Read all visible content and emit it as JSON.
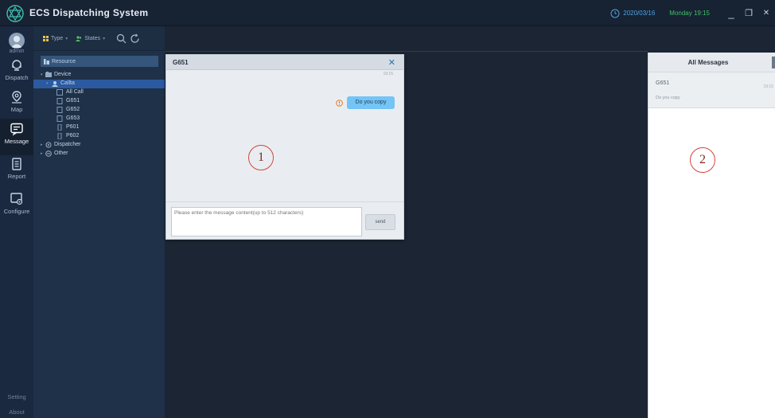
{
  "titlebar": {
    "app_title": "ECS Dispatching System",
    "date": "2020/03/16",
    "day_time": "Monday 19:15",
    "minimize": "_",
    "maximize": "❐",
    "close": "✕"
  },
  "user": {
    "name": "admin"
  },
  "nav": {
    "items": [
      {
        "label": "Dispatch",
        "icon": "dispatch-headset-icon"
      },
      {
        "label": "Map",
        "icon": "map-pin-icon"
      },
      {
        "label": "Message",
        "icon": "message-icon",
        "active": true
      },
      {
        "label": "Report",
        "icon": "report-document-icon"
      },
      {
        "label": "Configure",
        "icon": "configure-gear-icon"
      }
    ],
    "setting": "Setting",
    "about": "About"
  },
  "resource": {
    "type_label": "Type",
    "states_label": "States",
    "header": "Resource",
    "tree": [
      {
        "label": "Device",
        "level": 0
      },
      {
        "label": "Callta",
        "level": 1,
        "selected": true
      },
      {
        "label": "All Call",
        "level": 2
      },
      {
        "label": "G651",
        "level": 2
      },
      {
        "label": "G652",
        "level": 2
      },
      {
        "label": "G653",
        "level": 2
      },
      {
        "label": "P601",
        "level": 2
      },
      {
        "label": "P602",
        "level": 2
      },
      {
        "label": "Dispatcher",
        "level": 0
      },
      {
        "label": "Other",
        "level": 0
      }
    ]
  },
  "dialog": {
    "title": "G651",
    "close": "✕",
    "message_time": "19:15",
    "message_text": "Do you copy",
    "input_placeholder": "Please enter the message content(up to 512 characters)",
    "send_label": "send",
    "annotation": "1"
  },
  "messages_panel": {
    "title": "All Messages",
    "conversation": {
      "name": "G651",
      "time": "19:15",
      "preview": "Do you copy"
    },
    "annotation": "2"
  },
  "colors": {
    "titlebar_bg": "#172232",
    "nav_bg": "#1a2840",
    "panel_bg": "#1f3148",
    "center_bg": "#1b2533",
    "selected_row": "#2b5aa0",
    "bubble": "#74c4f5",
    "date_blue": "#4fa3e3",
    "day_green": "#43c06a",
    "annotation_red": "#d0463b",
    "warning_orange": "#e8771f"
  }
}
